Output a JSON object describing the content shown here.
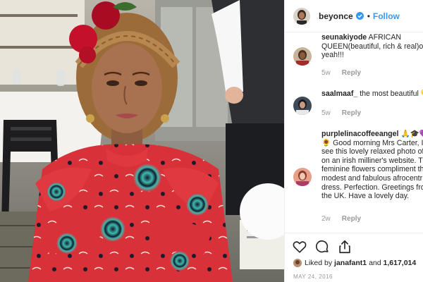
{
  "header": {
    "username": "beyonce",
    "separator": "•",
    "follow_label": "Follow"
  },
  "comments": [
    {
      "username": "seunakiyode",
      "lines": [
        "AFRICAN",
        "QUEEN(beautiful, rich & real)oh",
        "yeah!!!"
      ],
      "time": "5w",
      "reply_label": "Reply"
    },
    {
      "username": "saalmaaf_",
      "lines": [
        "the most beautiful 💛"
      ],
      "time": "5w",
      "reply_label": "Reply"
    },
    {
      "username": "purplelinacoffeeangel",
      "lines": [
        "🙏🎓💜",
        "🌻 Good morning Mrs Carter, I",
        "see this lovely relaxed photo of",
        "on an irish milliner's website. T",
        "feminine flowers compliment th",
        "modest and fabulous afrocentr",
        "dress. Perfection. Greetings fro",
        "the UK. Have a lovely day."
      ],
      "time": "2w",
      "reply_label": "Reply"
    }
  ],
  "likes": {
    "prefix": "Liked by",
    "user": "janafant1",
    "and": "and",
    "count": "1,617,014"
  },
  "date": "MAY 24, 2016",
  "icons": [
    "heart-icon",
    "comment-bubble-icon",
    "share-icon"
  ],
  "colors": {
    "accent_blue": "#3897f0",
    "dress_red": "#d8313a",
    "pattern_teal": "#3fb8b0",
    "flower_red": "#c4102a"
  }
}
